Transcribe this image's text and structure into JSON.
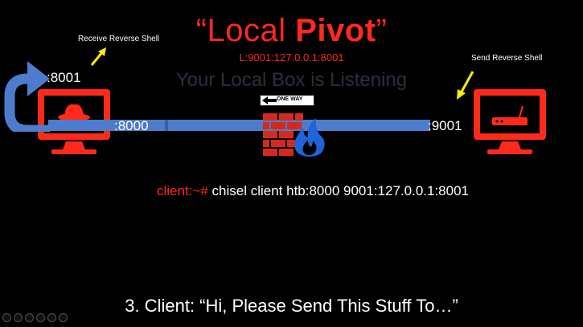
{
  "slide": {
    "title_quote_open": "“",
    "title_normal": "Local ",
    "title_bold": "Pivot",
    "title_quote_close": "”",
    "subtitle": "L:9001:127.0.0.1:8001",
    "listening_text": "Your Local Box is Listening",
    "receive_label": "Receive Reverse Shell",
    "send_label": "Send Reverse Shell",
    "port_8001": ":8001",
    "port_8000": ":8000",
    "port_9001": ":9001",
    "oneway_sign": "ONE WAY",
    "command_prompt": "client:~#",
    "command_text": " chisel client htb:8000 9001:127.0.0.1:8001",
    "step_text": "3. Client: “Hi, Please Send This Stuff To…”"
  },
  "colors": {
    "accent_red": "#ff2a1a",
    "tunnel_blue": "#4d7ccc",
    "arrow_yellow": "#ffee00",
    "background": "#000000"
  },
  "icons": [
    "hacker-monitor-icon",
    "router-monitor-icon",
    "firewall-icon",
    "curved-arrow-icon",
    "one-way-sign-icon"
  ]
}
